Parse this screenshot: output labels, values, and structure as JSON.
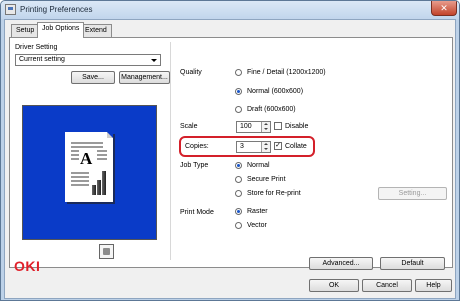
{
  "window": {
    "title": "Printing Preferences",
    "close_glyph": "✕"
  },
  "tabs": [
    "Setup",
    "Job Options",
    "Extend"
  ],
  "driver_setting": {
    "label": "Driver Setting",
    "selected": "Current setting",
    "save_label": "Save...",
    "management_label": "Management..."
  },
  "quality": {
    "label": "Quality",
    "options": [
      "Fine / Detail (1200x1200)",
      "Normal (600x600)",
      "Draft (600x600)"
    ],
    "selected_index": 1
  },
  "scale": {
    "label": "Scale",
    "value": "100",
    "disable_label": "Disable",
    "disable_checked": false
  },
  "copies": {
    "label": "Copies:",
    "value": "3",
    "collate_label": "Collate",
    "collate_checked": true,
    "check_glyph": "✓"
  },
  "job_type": {
    "label": "Job Type",
    "options": [
      "Normal",
      "Secure Print",
      "Store for Re-print"
    ],
    "selected_index": 0,
    "setting_label": "Setting..."
  },
  "print_mode": {
    "label": "Print Mode",
    "options": [
      "Raster",
      "Vector"
    ],
    "selected_index": 0
  },
  "preview": {
    "sample_letter": "A"
  },
  "brand": {
    "logo_text": "OKI",
    "color": "#e0202a"
  },
  "footer": {
    "advanced_label": "Advanced...",
    "default_label": "Default",
    "ok_label": "OK",
    "cancel_label": "Cancel",
    "help_label": "Help"
  },
  "colors": {
    "preview_bg": "#0a3bc8",
    "highlight_border": "#d4202a",
    "radio_accent": "#1a56c8"
  }
}
